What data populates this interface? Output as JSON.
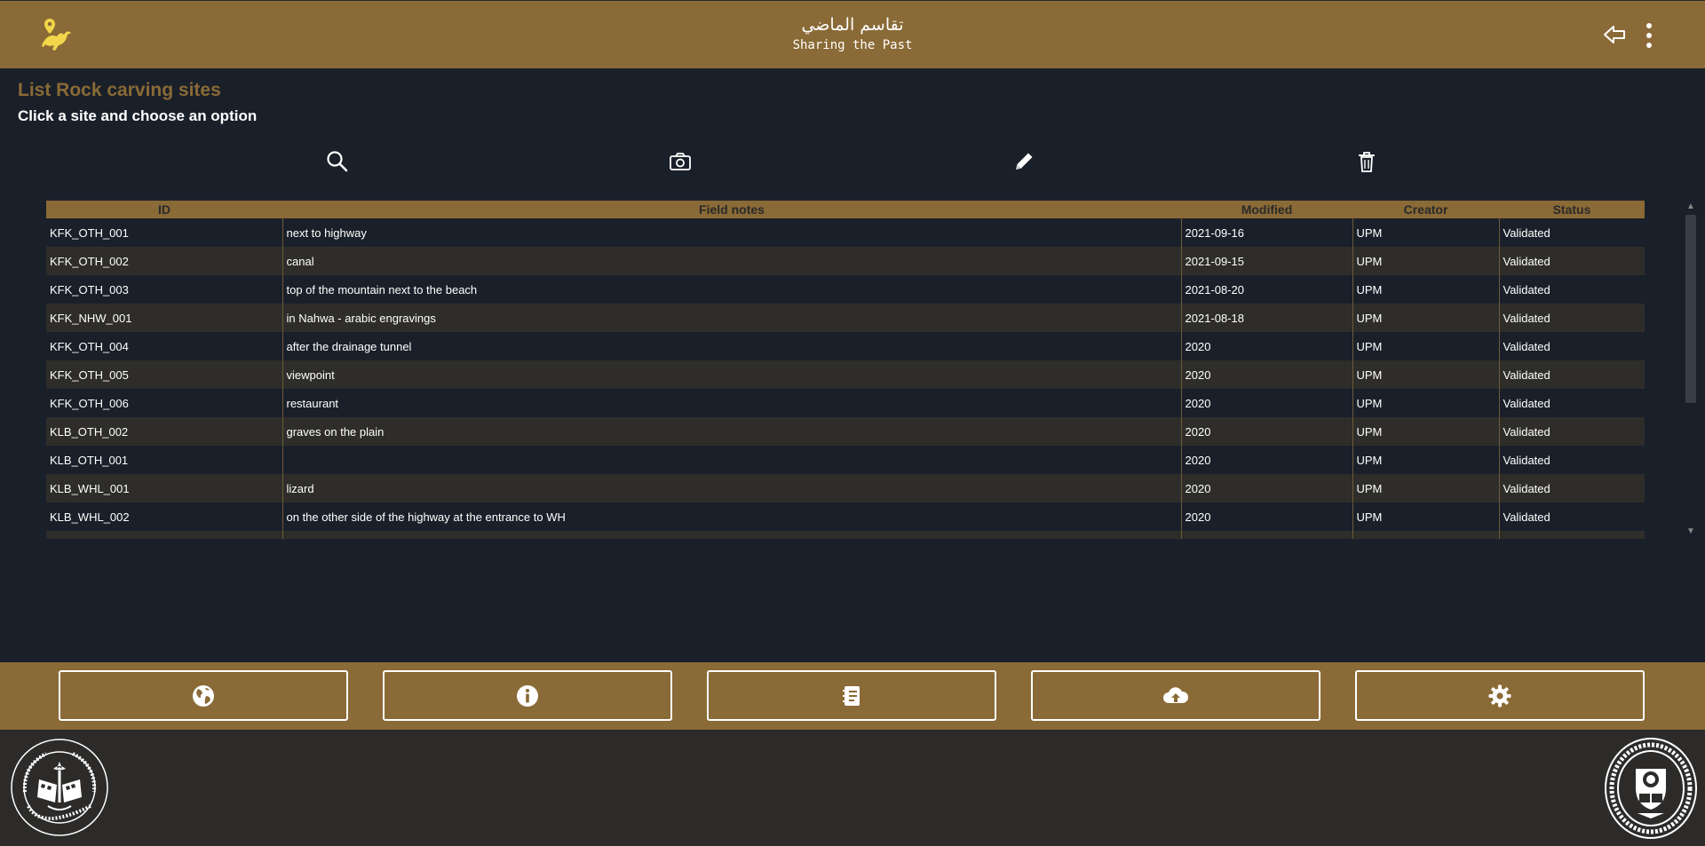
{
  "header": {
    "title_ar": "تقاسم الماضي",
    "title_en": "Sharing the Past",
    "icons": {
      "logo": "camel-pin-icon",
      "back": "back-arrow-icon",
      "menu": "kebab-menu-icon"
    }
  },
  "page": {
    "title": "List Rock carving sites",
    "subtitle": "Click a site and choose an option"
  },
  "toolbar": {
    "icons": [
      "search-icon",
      "camera-icon",
      "pencil-icon",
      "trash-icon"
    ]
  },
  "table": {
    "columns": [
      "ID",
      "Field notes",
      "Modified",
      "Creator",
      "Status"
    ],
    "rows": [
      [
        "KFK_OTH_001",
        "next to highway",
        "2021-09-16",
        "UPM",
        "Validated"
      ],
      [
        "KFK_OTH_002",
        "canal",
        "2021-09-15",
        "UPM",
        "Validated"
      ],
      [
        "KFK_OTH_003",
        "top of the mountain next to the beach",
        "2021-08-20",
        "UPM",
        "Validated"
      ],
      [
        "KFK_NHW_001",
        "in Nahwa - arabic engravings",
        "2021-08-18",
        "UPM",
        "Validated"
      ],
      [
        "KFK_OTH_004",
        "after the drainage tunnel",
        "2020",
        "UPM",
        "Validated"
      ],
      [
        "KFK_OTH_005",
        "viewpoint",
        "2020",
        "UPM",
        "Validated"
      ],
      [
        "KFK_OTH_006",
        "restaurant",
        "2020",
        "UPM",
        "Validated"
      ],
      [
        "KLB_OTH_002",
        "graves on the plain",
        "2020",
        "UPM",
        "Validated"
      ],
      [
        "KLB_OTH_001",
        "",
        "2020",
        "UPM",
        "Validated"
      ],
      [
        "KLB_WHL_001",
        "lizard",
        "2020",
        "UPM",
        "Validated"
      ],
      [
        "KLB_WHL_002",
        "on the other side of the highway at the entrance to WH",
        "2020",
        "UPM",
        "Validated"
      ]
    ]
  },
  "bottom_nav": {
    "icons": [
      "globe-icon",
      "info-icon",
      "notebook-icon",
      "cloud-upload-icon",
      "gear-icon"
    ]
  },
  "footer": {
    "left_seal": {
      "name": "sharjah-archaeology-authority-seal",
      "text_ar": "حكومة الشارقة - هيئة الشارقة للآثار",
      "text_en": "Sharjah Archaeology Authority - Govt of Sharjah"
    },
    "right_seal": {
      "name": "universidad-politecnica-madrid-seal",
      "text": "UNIVERSIDAD POLITECNICA MADRID"
    }
  },
  "colors": {
    "accent": "#8a6a36",
    "background": "#1a2029",
    "footer": "#2c2b2a",
    "row_alt": "#2e2d2a"
  }
}
